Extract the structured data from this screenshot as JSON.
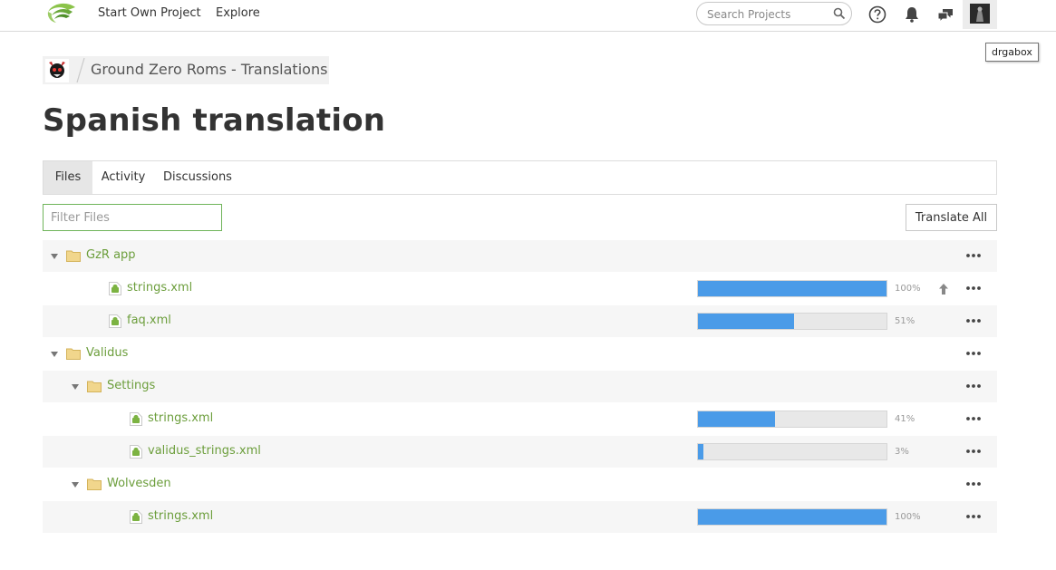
{
  "navbar": {
    "start_project": "Start Own Project",
    "explore": "Explore",
    "search_placeholder": "Search Projects",
    "tooltip": "drgabox"
  },
  "breadcrumb": {
    "project_title": "Ground Zero Roms - Translations"
  },
  "page_title": "Spanish translation",
  "tabs": [
    {
      "label": "Files",
      "active": true
    },
    {
      "label": "Activity",
      "active": false
    },
    {
      "label": "Discussions",
      "active": false
    }
  ],
  "filter": {
    "placeholder": "Filter Files"
  },
  "translate_all_label": "Translate All",
  "tree": [
    {
      "type": "folder",
      "name": "GzR app",
      "level": 0
    },
    {
      "type": "file",
      "name": "strings.xml",
      "level": 1,
      "progress": 100,
      "progress_text": "100%",
      "upload": true
    },
    {
      "type": "file",
      "name": "faq.xml",
      "level": 1,
      "progress": 51,
      "progress_text": "51%"
    },
    {
      "type": "folder",
      "name": "Validus",
      "level": 0
    },
    {
      "type": "folder",
      "name": "Settings",
      "level": 1
    },
    {
      "type": "file",
      "name": "strings.xml",
      "level": 2,
      "progress": 41,
      "progress_text": "41%"
    },
    {
      "type": "file",
      "name": "validus_strings.xml",
      "level": 2,
      "progress": 3,
      "progress_text": "3%"
    },
    {
      "type": "folder",
      "name": "Wolvesden",
      "level": 1
    },
    {
      "type": "file",
      "name": "strings.xml",
      "level": 2,
      "progress": 100,
      "progress_text": "100%"
    }
  ],
  "colors": {
    "progress": "#4a9be8",
    "link_green": "#6c9e3c",
    "folder": "#e8c46a"
  }
}
